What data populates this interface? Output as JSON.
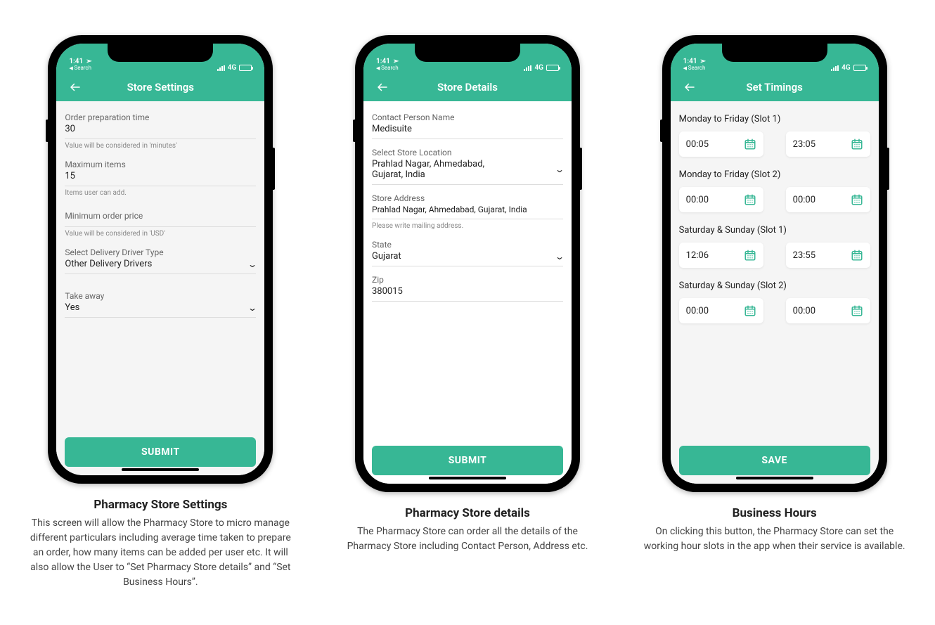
{
  "status": {
    "time": "1:41",
    "search_label": "Search",
    "net": "4G"
  },
  "phones": [
    {
      "header": "Store Settings",
      "caption_title": "Pharmacy Store Settings",
      "caption_desc": "This screen will allow the Pharmacy Store to micro manage different particulars including average time taken to prepare an order, how many items can be added per user etc. It will also allow the User to “Set Pharmacy Store details” and “Set Business Hours”.",
      "fields": {
        "prep_label": "Order preparation time",
        "prep_value": "30",
        "prep_hint": "Value will be considered in 'minutes'",
        "max_label": "Maximum items",
        "max_value": "15",
        "max_hint": "Items user can add.",
        "min_label": "Minimum order price",
        "min_value": "",
        "min_hint": "Value will be considered in 'USD'",
        "driver_label": "Select Delivery Driver Type",
        "driver_value": "Other Delivery Drivers",
        "takeaway_label": "Take away",
        "takeaway_value": "Yes"
      },
      "submit": "SUBMIT"
    },
    {
      "header": "Store Details",
      "caption_title": "Pharmacy Store details",
      "caption_desc": "The Pharmacy Store can order all the details of the Pharmacy Store including Contact Person, Address etc.",
      "fields": {
        "contact_label": "Contact Person Name",
        "contact_value": "Medisuite",
        "loc_label": "Select Store Location",
        "loc_value": "Prahlad Nagar, Ahmedabad, Gujarat, India",
        "addr_label": "Store Address",
        "addr_value": "Prahlad Nagar, Ahmedabad, Gujarat, India",
        "addr_hint": "Please write mailing address.",
        "state_label": "State",
        "state_value": "Gujarat",
        "zip_label": "Zip",
        "zip_value": "380015"
      },
      "submit": "SUBMIT"
    },
    {
      "header": "Set Timings",
      "caption_title": "Business Hours",
      "caption_desc": "On clicking this button, the Pharmacy Store can set the working hour slots in the app when their service is available.",
      "slots": [
        {
          "label": "Monday to Friday (Slot 1)",
          "from": "00:05",
          "to": "23:05"
        },
        {
          "label": "Monday to Friday (Slot 2)",
          "from": "00:00",
          "to": "00:00"
        },
        {
          "label": "Saturday & Sunday (Slot 1)",
          "from": "12:06",
          "to": "23:55"
        },
        {
          "label": "Saturday & Sunday (Slot 2)",
          "from": "00:00",
          "to": "00:00"
        }
      ],
      "submit": "SAVE"
    }
  ]
}
